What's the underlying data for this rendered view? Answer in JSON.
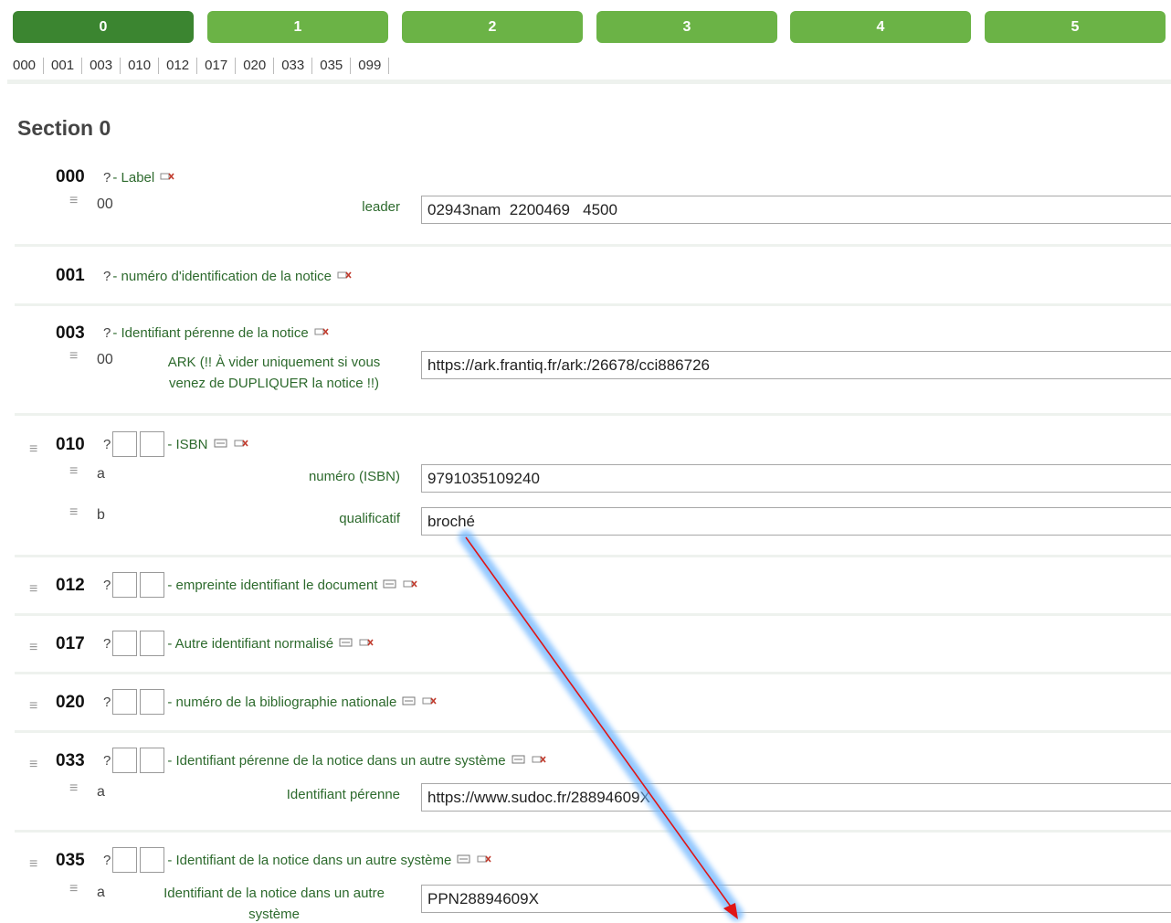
{
  "tabs": [
    "0",
    "1",
    "2",
    "3",
    "4",
    "5"
  ],
  "field_nav": [
    "000",
    "001",
    "003",
    "010",
    "012",
    "017",
    "020",
    "033",
    "035",
    "099"
  ],
  "section_title": "Section 0",
  "fields": {
    "f000": {
      "tag": "000",
      "q": "?",
      "label": "- Label",
      "subs": [
        {
          "code": "00",
          "label": "leader",
          "value": "02943nam  2200469   4500"
        }
      ]
    },
    "f001": {
      "tag": "001",
      "q": "?",
      "label": "- numéro d'identification de la notice"
    },
    "f003": {
      "tag": "003",
      "q": "?",
      "label": "- Identifiant pérenne de la notice",
      "subs": [
        {
          "code": "00",
          "label_line1": "ARK (!! À vider uniquement si vous",
          "label_line2": "venez de DUPLIQUER la notice !!)",
          "value": "https://ark.frantiq.fr/ark:/26678/cci886726"
        }
      ]
    },
    "f010": {
      "tag": "010",
      "q": "?",
      "label": "- ISBN",
      "subs": [
        {
          "code": "a",
          "label": "numéro (ISBN)",
          "value": "9791035109240"
        },
        {
          "code": "b",
          "label": "qualificatif",
          "value": "broché"
        }
      ]
    },
    "f012": {
      "tag": "012",
      "q": "?",
      "label": "- empreinte identifiant le document"
    },
    "f017": {
      "tag": "017",
      "q": "?",
      "label": "- Autre identifiant normalisé"
    },
    "f020": {
      "tag": "020",
      "q": "?",
      "label": "- numéro de la bibliographie nationale"
    },
    "f033": {
      "tag": "033",
      "q": "?",
      "label": "- Identifiant pérenne de la notice dans un autre système",
      "subs": [
        {
          "code": "a",
          "label": "Identifiant pérenne",
          "value": "https://www.sudoc.fr/28894609X"
        }
      ]
    },
    "f035": {
      "tag": "035",
      "q": "?",
      "label": "- Identifiant de la notice dans un autre système",
      "subs": [
        {
          "code": "a",
          "label_line1": "Identifiant de la notice dans un autre",
          "label_line2": "système",
          "value": "PPN28894609X"
        }
      ]
    }
  },
  "colors": {
    "tab": "#6bb346",
    "tab_active": "#3b8530",
    "label": "#2d6a2d",
    "arrow": "#e01515",
    "arrow_glow": "#6fb6ff"
  }
}
